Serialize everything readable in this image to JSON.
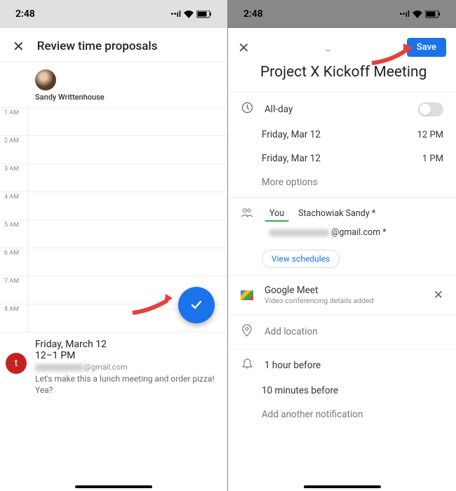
{
  "status": {
    "time": "2:48",
    "signal": "••ıl",
    "wifi": "wifi",
    "battery": "bat"
  },
  "left": {
    "title": "Review time proposals",
    "attendee": "Sandy Writtenhouse",
    "hours": [
      "1 AM",
      "2 AM",
      "3 AM",
      "4 AM",
      "5 AM",
      "6 AM",
      "7 AM",
      "8 AM"
    ],
    "proposal": {
      "day": "Friday, March 12",
      "time": "12–1 PM",
      "email_suffix": "@gmail.com",
      "note": "Let's make this a lunch meeting and order pizza! Yea?",
      "badge": "t"
    }
  },
  "right": {
    "save_label": "Save",
    "event_title": "Project X Kickoff Meeting",
    "allday_label": "All-day",
    "start_day": "Friday, Mar 12",
    "start_time": "12 PM",
    "end_day": "Friday, Mar 12",
    "end_time": "1 PM",
    "more_options": "More options",
    "people": {
      "you": "You",
      "p2": "Stachowiak Sandy *",
      "p3_suffix": "@gmail.com *"
    },
    "view_schedules": "View schedules",
    "meet_title": "Google Meet",
    "meet_sub": "Video conferencing details added",
    "location": "Add location",
    "notif1": "1 hour before",
    "notif2": "10 minutes before",
    "notif_add": "Add another notification"
  }
}
